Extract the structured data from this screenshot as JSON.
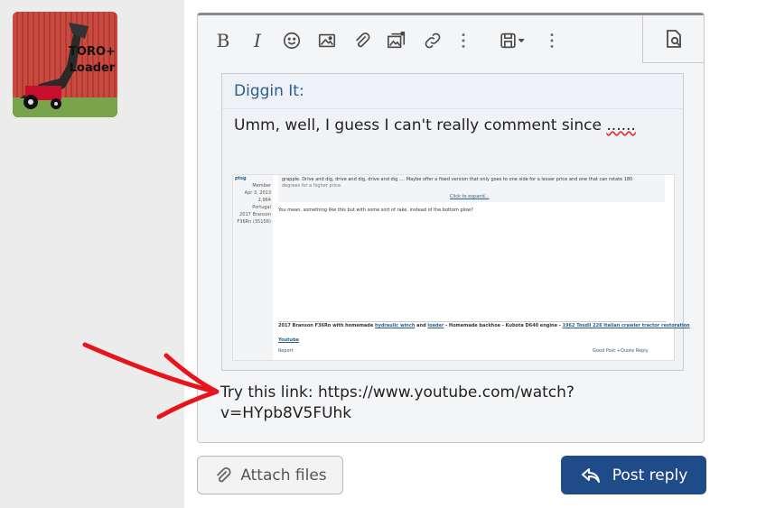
{
  "sidebar": {
    "avatar": {
      "logo_line1": "TORO+",
      "logo_line2": "Loader"
    }
  },
  "toolbar": {
    "icons": [
      "bold-icon",
      "italic-icon",
      "smile-icon",
      "image-icon",
      "paperclip-icon",
      "media-gallery-icon",
      "link-icon",
      "more-vertical-icon",
      "save-draft-icon",
      "more-vertical-icon",
      "preview-icon"
    ],
    "bold_glyph": "B",
    "italic_glyph": "I"
  },
  "quote": {
    "author": "Diggin It:",
    "text_main": "Umm, well, I guess I can't really comment since ",
    "text_dots": "......"
  },
  "embedded_screenshot": {
    "user": {
      "name": "ptsg",
      "role": "Member",
      "joined": "Apr 3, 2013",
      "posts": "2,964",
      "location": "Portugal",
      "tractor1": "2017 Branson",
      "tractor2": "F36Rn (3515R)"
    },
    "quote_line1": "grapple. Drive and dig, drive and dig, drive and dig .... Maybe offer a fixed version that only goes to one side for a lesser price and one that can rotate 180",
    "quote_line2": "degrees for a higher price.",
    "expand": "Click to expand...",
    "reply": "You mean, something like this but with some sort of rake, instead of the bottom plow?",
    "sig_prefix": "2017 Branson F36Rn with homemade ",
    "sig_link1": "hydraulic winch",
    "sig_and": " and ",
    "sig_link2": "loader",
    "sig_rest": " - Homemade backhoe - Kubota D640 engine - ",
    "sig_link3": "1962 Tosdli 226 Italian crawler tractor restoration",
    "sig_link4": "Youtube",
    "report": "Report",
    "actions": "Good Post   +Quote   Reply"
  },
  "reply": {
    "line1": "Try this link: https://www.youtube.com/watch?",
    "line2": "v=HYpb8V5FUhk"
  },
  "buttons": {
    "attach_label": "Attach files",
    "post_label": "Post reply"
  },
  "colors": {
    "post_button": "#1f4b88",
    "annotation_arrow": "#e8141b",
    "quote_author": "#2c5f8a"
  }
}
